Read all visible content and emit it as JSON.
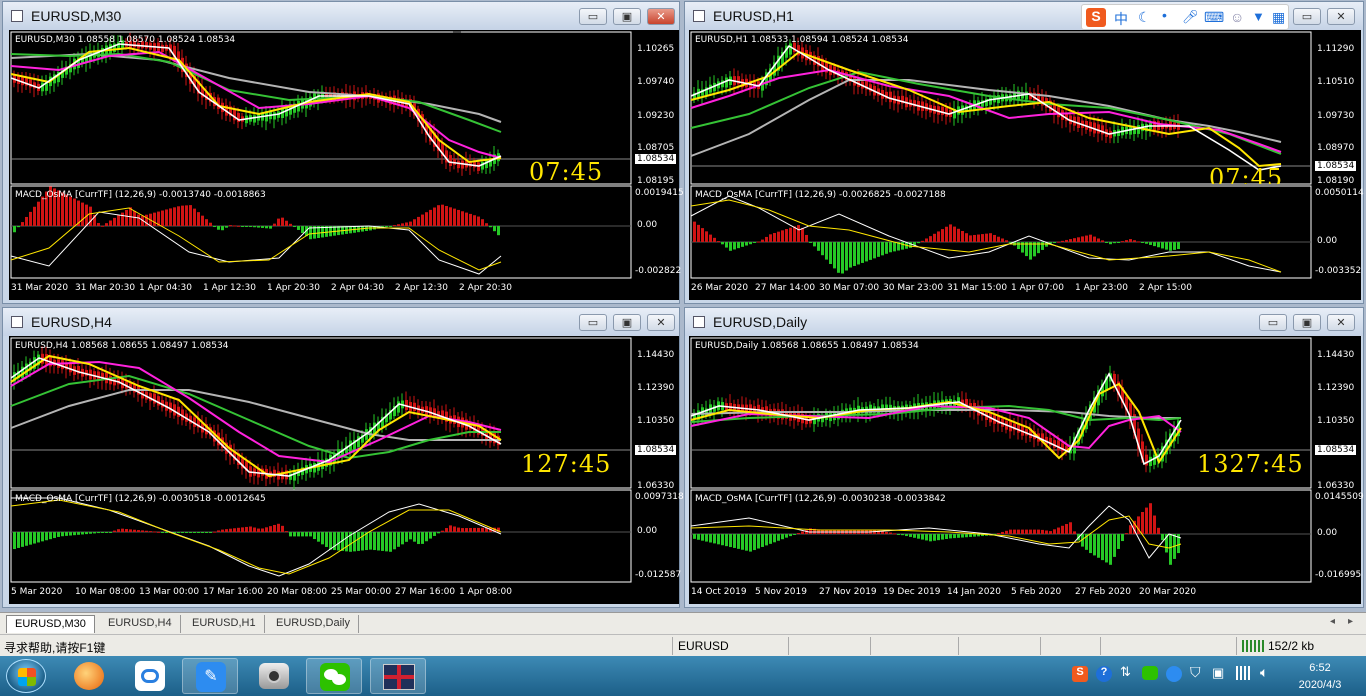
{
  "windows": [
    {
      "id": "m30",
      "title": "EURUSD,M30",
      "header": "EURUSD,M30  1.08558 1.08570 1.08524 1.08534",
      "price_labels": [
        "1.10265",
        "1.09740",
        "1.09230",
        "1.08705",
        "1.08195"
      ],
      "current_price": "1.08534",
      "timer": "07:45",
      "macd_header": "MACD_OsMA [CurrTF] (12,26,9) -0.0013740 -0.0018863",
      "macd_labels": [
        "0.0019415",
        "0.00",
        "-0.002822"
      ],
      "time_labels": [
        "31 Mar 2020",
        "31 Mar 20:30",
        "1 Apr 04:30",
        "1 Apr 12:30",
        "1 Apr 20:30",
        "2 Apr 04:30",
        "2 Apr 12:30",
        "2 Apr 20:30"
      ]
    },
    {
      "id": "h1",
      "title": "EURUSD,H1",
      "header": "EURUSD,H1  1.08533 1.08594 1.08524 1.08534",
      "price_labels": [
        "1.11290",
        "1.10510",
        "1.09730",
        "1.08970",
        "1.08190"
      ],
      "current_price": "1.08534",
      "timer": "07:45",
      "macd_header": "MACD_OsMA [CurrTF] (12,26,9) -0.0026825 -0.0027188",
      "macd_labels": [
        "0.0050114",
        "0.00",
        "-0.003352"
      ],
      "time_labels": [
        "26 Mar 2020",
        "27 Mar 14:00",
        "30 Mar 07:00",
        "30 Mar 23:00",
        "31 Mar 15:00",
        "1 Apr 07:00",
        "1 Apr 23:00",
        "2 Apr 15:00"
      ]
    },
    {
      "id": "h4",
      "title": "EURUSD,H4",
      "header": "EURUSD,H4  1.08568 1.08655 1.08497 1.08534",
      "price_labels": [
        "1.14430",
        "1.12390",
        "1.10350",
        "1.06330"
      ],
      "current_price": "1.08534",
      "timer": "127:45",
      "macd_header": "MACD_OsMA [CurrTF] (12,26,9) -0.0030518 -0.0012645",
      "macd_labels": [
        "0.0097318",
        "0.00",
        "-0.012587"
      ],
      "time_labels": [
        "5 Mar 2020",
        "10 Mar 08:00",
        "13 Mar 00:00",
        "17 Mar 16:00",
        "20 Mar 08:00",
        "25 Mar 00:00",
        "27 Mar 16:00",
        "1 Apr 08:00"
      ]
    },
    {
      "id": "daily",
      "title": "EURUSD,Daily",
      "header": "EURUSD,Daily  1.08568 1.08655 1.08497 1.08534",
      "price_labels": [
        "1.14430",
        "1.12390",
        "1.10350",
        "1.06330"
      ],
      "current_price": "1.08534",
      "timer": "1327:45",
      "macd_header": "MACD_OsMA [CurrTF] (12,26,9) -0.0030238 -0.0033842",
      "macd_labels": [
        "0.0145509",
        "0.00",
        "-0.016995"
      ],
      "time_labels": [
        "14 Oct 2019",
        "5 Nov 2019",
        "27 Nov 2019",
        "19 Dec 2019",
        "14 Jan 2020",
        "5 Feb 2020",
        "27 Feb 2020",
        "20 Mar 2020"
      ]
    }
  ],
  "window_buttons": {
    "minimize": "▭",
    "maximize": "▣",
    "close": "✕"
  },
  "tabs": [
    "EURUSD,M30",
    "EURUSD,H4",
    "EURUSD,H1",
    "EURUSD,Daily"
  ],
  "active_tab": "EURUSD,M30",
  "status": {
    "help": "寻求帮助,请按F1键",
    "symbol": "EURUSD",
    "traffic": "152/2 kb"
  },
  "ime_bar": {
    "logo": "S",
    "lang": "中",
    "items": [
      "moon-icon",
      "mic-icon",
      "keyboard-icon",
      "user-icon",
      "shirt-icon",
      "grid-icon"
    ]
  },
  "taskbar": {
    "clock_time": "6:52",
    "clock_date": "2020/4/3",
    "apps": [
      "start-orb",
      "fox-app-icon",
      "baidu-netdisk-icon",
      "notes-app-icon",
      "camera-app-icon",
      "wechat-icon",
      "mt4-flag-icon"
    ]
  },
  "colors": {
    "bull": "#26c826",
    "bear": "#d01414",
    "ma_white": "#ffffff",
    "ma_yellow": "#ffe600",
    "ma_magenta": "#ff22dd",
    "ma_green": "#35c235",
    "ma_gray": "#b4b4b4",
    "timer": "#ffe600",
    "window_frame": "#c9d7e8",
    "taskbar": "#2a77a3"
  }
}
